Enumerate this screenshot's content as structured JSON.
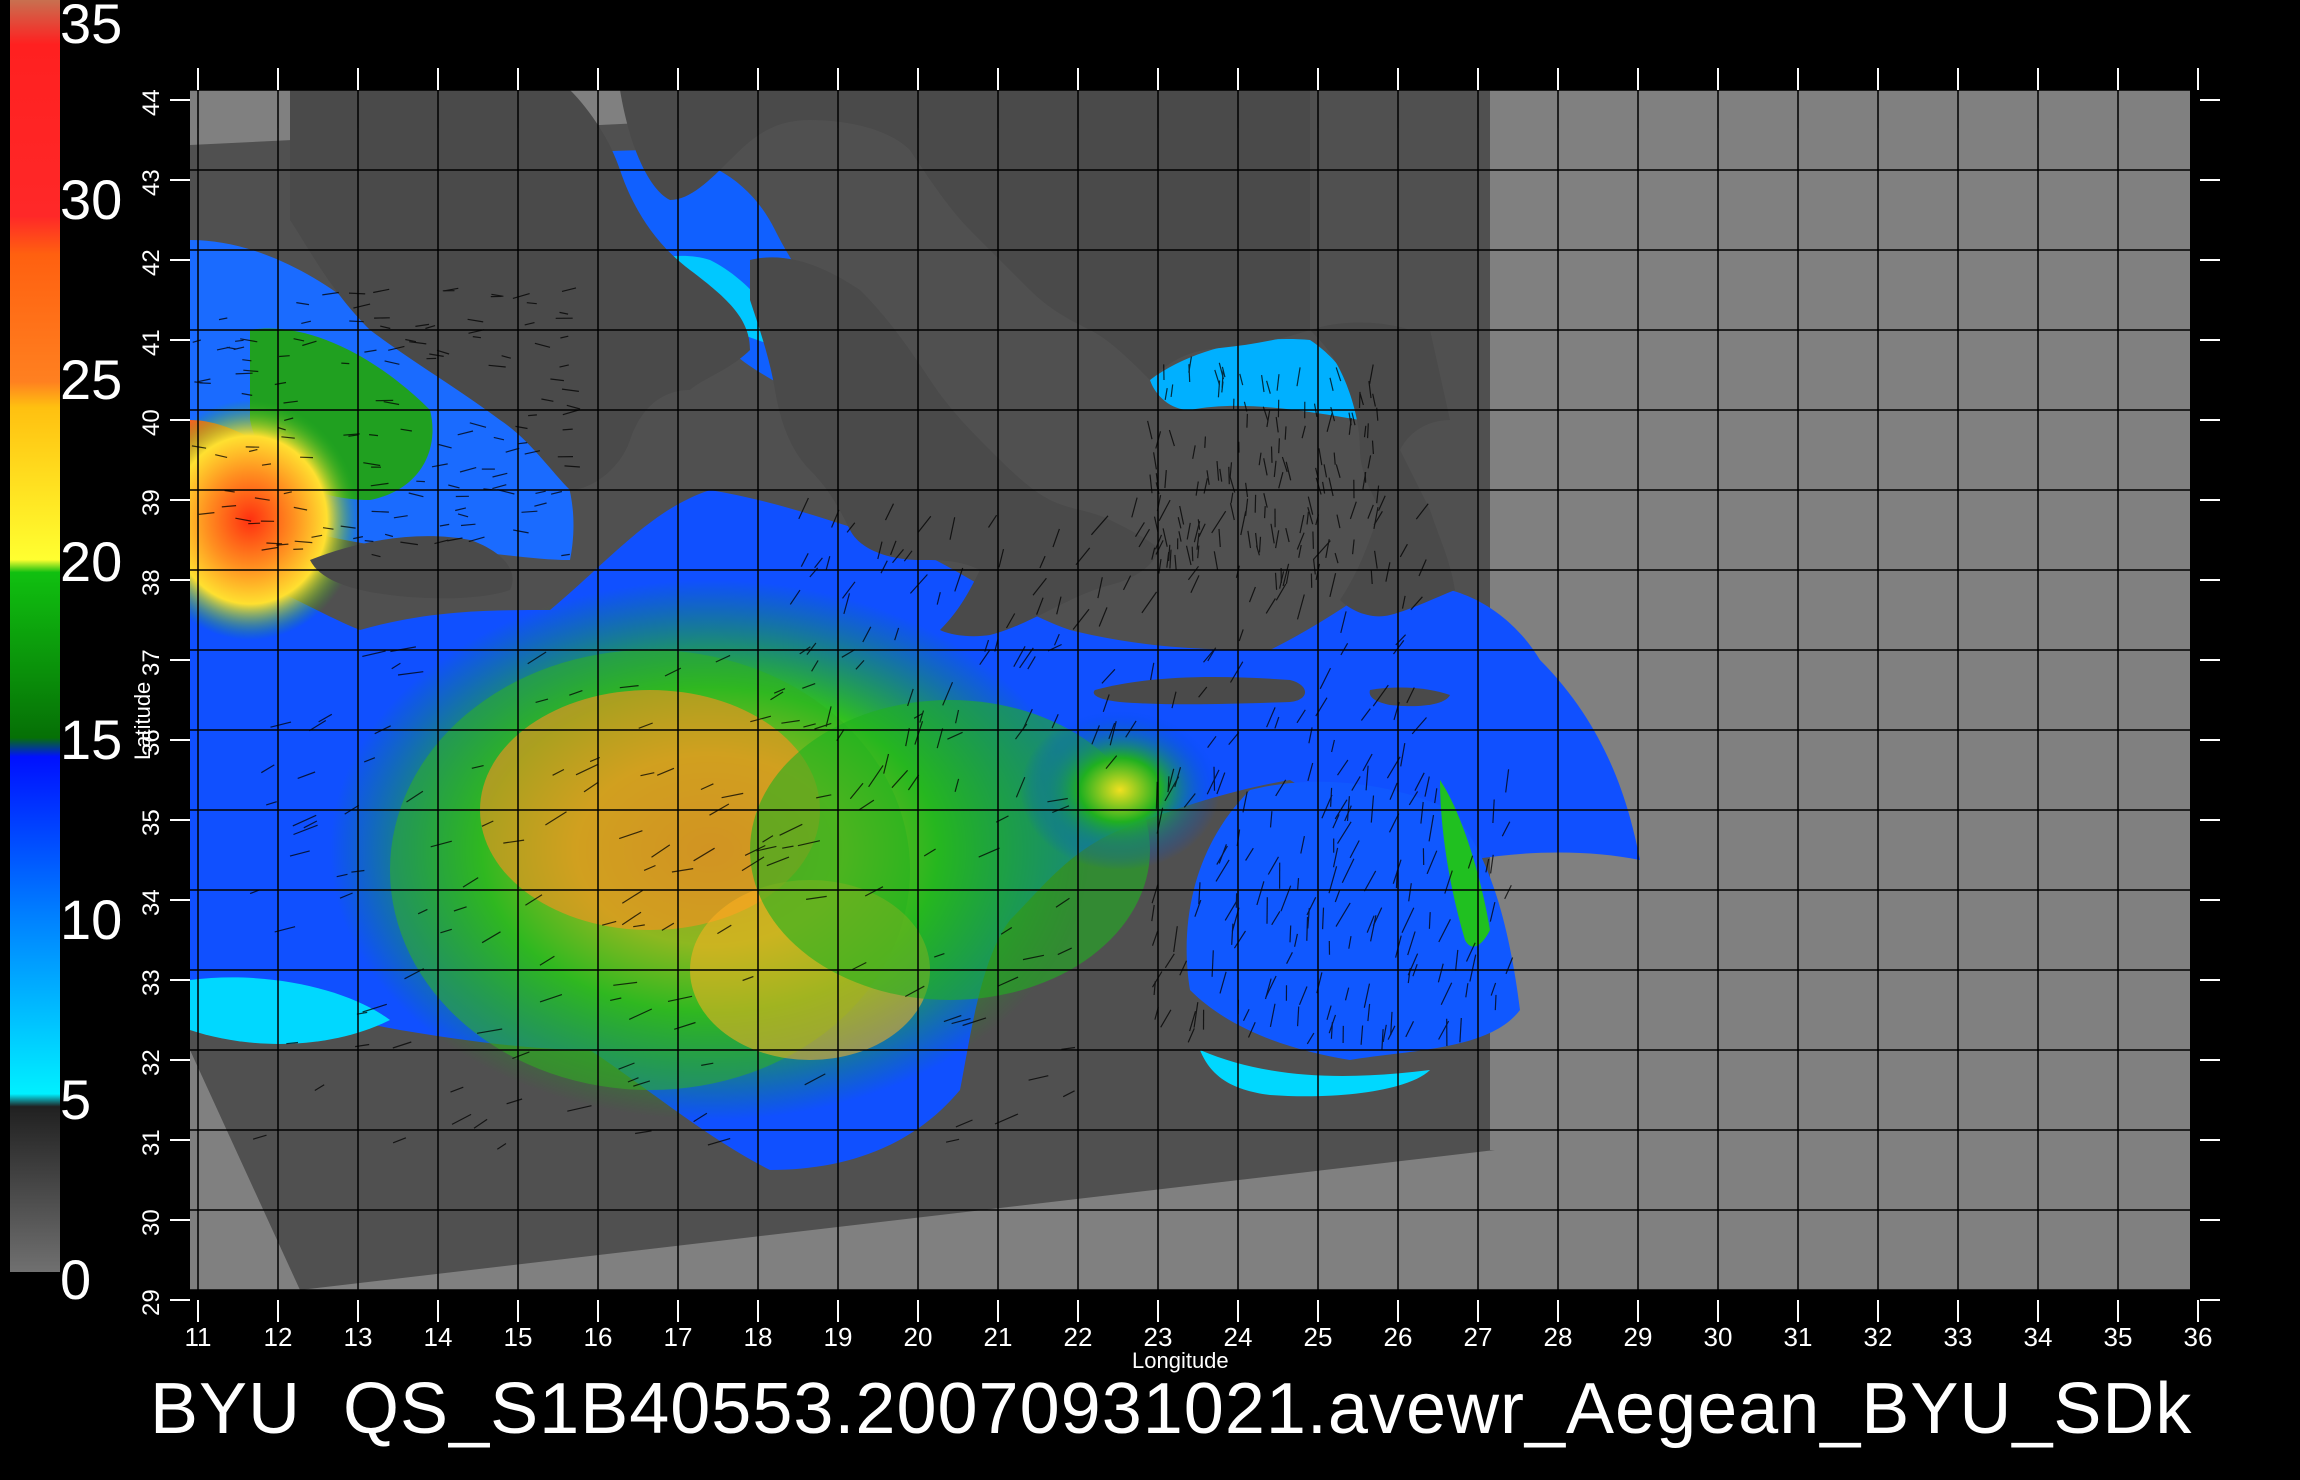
{
  "colorbar": {
    "labels": [
      "35",
      "30",
      "25",
      "20",
      "15",
      "10",
      "5",
      "0"
    ],
    "colors": {
      "top": "#c87050",
      "red": "#ff2020",
      "orange": "#ff7a10",
      "yellow": "#ffe020",
      "green": "#10b010",
      "darkgreen": "#067006",
      "blue": "#0028ff",
      "lightblue": "#00a8ff",
      "cyan": "#00f0ff",
      "darkgray": "#202020",
      "gray": "#6a6a6a"
    }
  },
  "axes": {
    "xlabel": "Longitude",
    "ylabel": "Latitude",
    "lon_ticks": [
      "11",
      "12",
      "13",
      "14",
      "15",
      "16",
      "17",
      "18",
      "19",
      "20",
      "21",
      "22",
      "23",
      "24",
      "25",
      "26",
      "27",
      "28",
      "29",
      "30",
      "31",
      "32",
      "33",
      "34",
      "35",
      "36"
    ],
    "lat_ticks": [
      "29",
      "30",
      "31",
      "32",
      "33",
      "34",
      "35",
      "36",
      "37",
      "38",
      "39",
      "40",
      "41",
      "42",
      "43",
      "44"
    ]
  },
  "footer": {
    "text": "BYU  QS_S1B40553.20070931021.avewr_Aegean_BYU_SDk"
  },
  "map_colors": {
    "background": "#808080",
    "swath": "#505050",
    "land": "#4a4a4a",
    "grid": "#000000"
  }
}
